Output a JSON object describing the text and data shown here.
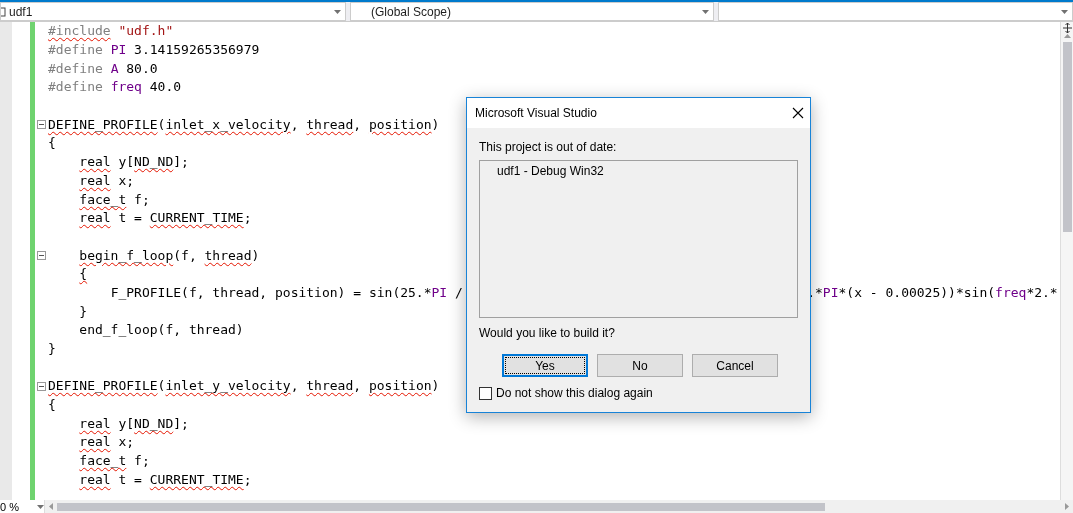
{
  "navigation_bar": {
    "project": "udf1",
    "scope": "(Global Scope)"
  },
  "code_lines": [
    {
      "kind": "code",
      "tokens": [
        {
          "text": "#include ",
          "kind": "pre-err"
        },
        {
          "text": "\"udf.h\"",
          "kind": "string"
        }
      ]
    },
    {
      "kind": "code",
      "tokens": [
        {
          "text": "#define ",
          "kind": "pre"
        },
        {
          "text": "PI",
          "kind": "macro"
        },
        {
          "text": " 3.14159265356979",
          "kind": "plain"
        }
      ]
    },
    {
      "kind": "code",
      "tokens": [
        {
          "text": "#define ",
          "kind": "pre"
        },
        {
          "text": "A",
          "kind": "macro"
        },
        {
          "text": " 80.0",
          "kind": "plain"
        }
      ]
    },
    {
      "kind": "code",
      "tokens": [
        {
          "text": "#define ",
          "kind": "pre"
        },
        {
          "text": "freq",
          "kind": "macro"
        },
        {
          "text": " 40.0",
          "kind": "plain"
        }
      ]
    },
    {
      "kind": "blank"
    },
    {
      "kind": "block-start",
      "expanded": true,
      "tokens": [
        {
          "text": "DEFINE_PROFILE",
          "kind": "err"
        },
        {
          "text": "(",
          "kind": "plain"
        },
        {
          "text": "inlet_x_velocity",
          "kind": "err"
        },
        {
          "text": ", ",
          "kind": "plain"
        },
        {
          "text": "thread",
          "kind": "err"
        },
        {
          "text": ", ",
          "kind": "plain"
        },
        {
          "text": "position",
          "kind": "err"
        },
        {
          "text": ")",
          "kind": "plain"
        }
      ]
    },
    {
      "kind": "code",
      "tokens": [
        {
          "text": "{",
          "kind": "plain"
        }
      ]
    },
    {
      "kind": "code",
      "tokens": [
        {
          "text": "    real",
          "kind": "err"
        },
        {
          "text": " y[",
          "kind": "plain"
        },
        {
          "text": "ND_ND",
          "kind": "err"
        },
        {
          "text": "];",
          "kind": "plain"
        }
      ]
    },
    {
      "kind": "code",
      "tokens": [
        {
          "text": "    real",
          "kind": "err"
        },
        {
          "text": " x;",
          "kind": "plain"
        }
      ]
    },
    {
      "kind": "code",
      "tokens": [
        {
          "text": "    face_t",
          "kind": "err"
        },
        {
          "text": " f;",
          "kind": "plain"
        }
      ]
    },
    {
      "kind": "code",
      "tokens": [
        {
          "text": "    real",
          "kind": "err"
        },
        {
          "text": " t = ",
          "kind": "plain"
        },
        {
          "text": "CURRENT_TIME",
          "kind": "err"
        },
        {
          "text": ";",
          "kind": "plain"
        }
      ]
    },
    {
      "kind": "blank"
    },
    {
      "kind": "block-start",
      "expanded": true,
      "tokens": [
        {
          "text": "    begin_f_loop",
          "kind": "err"
        },
        {
          "text": "(f, ",
          "kind": "plain"
        },
        {
          "text": "thread",
          "kind": "err"
        },
        {
          "text": ")",
          "kind": "plain"
        }
      ]
    },
    {
      "kind": "code",
      "tokens": [
        {
          "text": "    {",
          "kind": "err"
        }
      ]
    },
    {
      "kind": "split",
      "tokens": [
        {
          "text": "        F_PROFILE(f, thread, position) = sin(25.*",
          "kind": "plain"
        },
        {
          "text": "PI",
          "kind": "macro"
        },
        {
          "text": " /",
          "kind": "plain"
        }
      ],
      "tokens_right": [
        {
          "text": ".*",
          "kind": "plain"
        },
        {
          "text": "PI",
          "kind": "macro"
        },
        {
          "text": "*(x - 0.00025))*sin(",
          "kind": "plain"
        },
        {
          "text": "freq",
          "kind": "macro"
        },
        {
          "text": "*2.*",
          "kind": "plain"
        }
      ]
    },
    {
      "kind": "code",
      "tokens": [
        {
          "text": "    }",
          "kind": "plain"
        }
      ]
    },
    {
      "kind": "code",
      "tokens": [
        {
          "text": "    end_f_loop(f, thread)",
          "kind": "plain"
        }
      ]
    },
    {
      "kind": "code",
      "tokens": [
        {
          "text": "}",
          "kind": "plain"
        }
      ]
    },
    {
      "kind": "blank"
    },
    {
      "kind": "block-start",
      "expanded": true,
      "tokens": [
        {
          "text": "DEFINE_PROFILE",
          "kind": "err"
        },
        {
          "text": "(",
          "kind": "plain"
        },
        {
          "text": "inlet_y_velocity",
          "kind": "err"
        },
        {
          "text": ", ",
          "kind": "plain"
        },
        {
          "text": "thread",
          "kind": "err"
        },
        {
          "text": ", ",
          "kind": "plain"
        },
        {
          "text": "position",
          "kind": "err"
        },
        {
          "text": ")",
          "kind": "plain"
        }
      ]
    },
    {
      "kind": "code",
      "tokens": [
        {
          "text": "{",
          "kind": "plain"
        }
      ]
    },
    {
      "kind": "code",
      "tokens": [
        {
          "text": "    real",
          "kind": "err"
        },
        {
          "text": " y[",
          "kind": "plain"
        },
        {
          "text": "ND_ND",
          "kind": "err"
        },
        {
          "text": "];",
          "kind": "plain"
        }
      ]
    },
    {
      "kind": "code",
      "tokens": [
        {
          "text": "    real",
          "kind": "err"
        },
        {
          "text": " x;",
          "kind": "plain"
        }
      ]
    },
    {
      "kind": "code",
      "tokens": [
        {
          "text": "    face_t",
          "kind": "err"
        },
        {
          "text": " f;",
          "kind": "plain"
        }
      ]
    },
    {
      "kind": "code",
      "tokens": [
        {
          "text": "    real",
          "kind": "err"
        },
        {
          "text": " t = ",
          "kind": "plain"
        },
        {
          "text": "CURRENT_TIME",
          "kind": "err"
        },
        {
          "text": ";",
          "kind": "plain"
        }
      ]
    }
  ],
  "zoom": "0 %",
  "dialog": {
    "title": "Microsoft Visual Studio",
    "message": "This project is out of date:",
    "projects": [
      "udf1 - Debug Win32"
    ],
    "question": "Would you like to build it?",
    "buttons": [
      {
        "label": "Yes",
        "focused": true
      },
      {
        "label": "No",
        "focused": false
      },
      {
        "label": "Cancel",
        "focused": false
      }
    ],
    "checkbox": {
      "label": "Do not show this dialog again",
      "checked": false
    }
  }
}
